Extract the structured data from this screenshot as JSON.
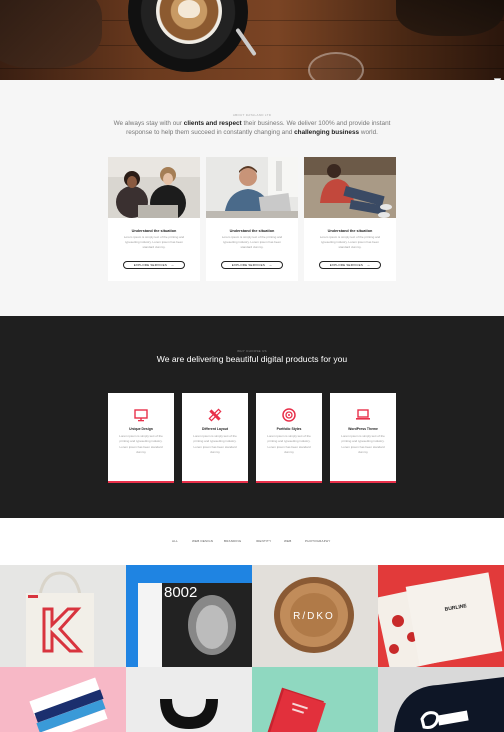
{
  "about": {
    "eyebrow": "ABOUT DATALAND LTD",
    "lead_1": "We always stay with our ",
    "lead_b1": "clients and respect",
    "lead_2": " their business. We deliver 100% and provide instant response to help them succeed in constantly changing and ",
    "lead_b2": "challenging business",
    "lead_3": " world.",
    "cards": [
      {
        "title": "Understand the situation",
        "text": "Lorem ipsum is simply text of the printing and typesetting industry. Lorem ipsum has been standard dummy.",
        "button": "EXPLORE SERVICES"
      },
      {
        "title": "Understand the situation",
        "text": "Lorem ipsum is simply text of the printing and typesetting industry. Lorem ipsum has been standard dummy.",
        "button": "EXPLORE SERVICES"
      },
      {
        "title": "Understand the situation",
        "text": "Lorem ipsum is simply text of the printing and typesetting industry. Lorem ipsum has been standard dummy.",
        "button": "EXPLORE SERVICES"
      }
    ]
  },
  "services": {
    "eyebrow": "WHY CHOOSE US",
    "heading": "We are delivering beautiful digital products for you",
    "items": [
      {
        "title": "Unique Design",
        "text": "Lorem ipsum is simply text of the printing and typesetting industry. Lorem ipsum has been standard dummy",
        "icon": "monitor-icon"
      },
      {
        "title": "Different Layout",
        "text": "Lorem ipsum is simply text of the printing and typesetting industry. Lorem ipsum has been standard dummy",
        "icon": "pencil-ruler-icon"
      },
      {
        "title": "Portfolio Styles",
        "text": "Lorem ipsum is simply text of the printing and typesetting industry. Lorem ipsum has been standard dummy",
        "icon": "target-icon"
      },
      {
        "title": "WordPress Theme",
        "text": "Lorem ipsum is simply text of the printing and typesetting industry. Lorem ipsum has been standard dummy",
        "icon": "laptop-icon"
      }
    ],
    "accent": "#e8304a"
  },
  "portfolio": {
    "filters": [
      "ALL",
      "WEB DESIGN",
      "BRANDING",
      "IDENTITY",
      "WEB",
      "PHOTOGRAPHY"
    ],
    "tile_texts": {
      "t2": "8002",
      "t3": "R/DKO",
      "t4": "BURLINE"
    }
  }
}
